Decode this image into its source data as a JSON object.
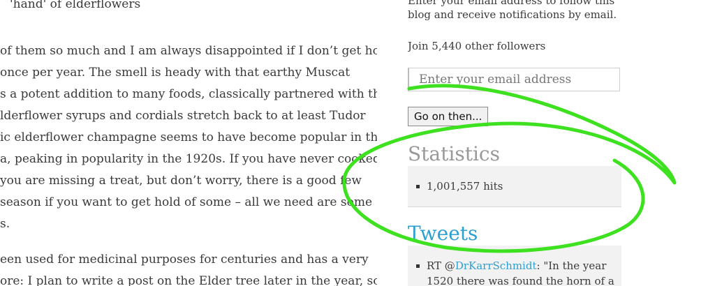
{
  "article": {
    "heading_fragment": "'hand' of elderflowers",
    "para1": [
      "of them so much and I am always disappointed if I don’t get hold",
      "once per year. The smell is heady with that earthy Muscat",
      "s a potent addition to many foods, classically partnered with the",
      "lderflower syrups and cordials stretch back to at least Tudor",
      "ic elderflower champagne seems to have become popular in the",
      "a, peaking in popularity in the 1920s. If you have never cooked",
      "you are missing a treat, but don’t worry, there is a good few",
      " season if you want to get hold of some – all we need are some",
      "s."
    ],
    "para2": [
      "een used for medicinal purposes for centuries and has a very",
      "ore: I plan to write a post on the Elder tree later in the year, so"
    ]
  },
  "sidebar": {
    "follow_line1": "Enter your email address to follow this",
    "follow_line2": "blog and receive notifications by email.",
    "followers": "Join 5,440 other followers",
    "email_placeholder": "Enter your email address",
    "submit_label": "Go on then...",
    "stats_title": "Statistics",
    "stats_hits": "1,001,557 hits",
    "tweets_title": "Tweets",
    "tweet_prefix": "RT @",
    "tweet_handle": "DrKarrSchmidt",
    "tweet_text_1": ": \"In the year",
    "tweet_text_2": "1520 there was found the horn of a"
  },
  "annotation": {
    "color": "#3ee11f"
  }
}
